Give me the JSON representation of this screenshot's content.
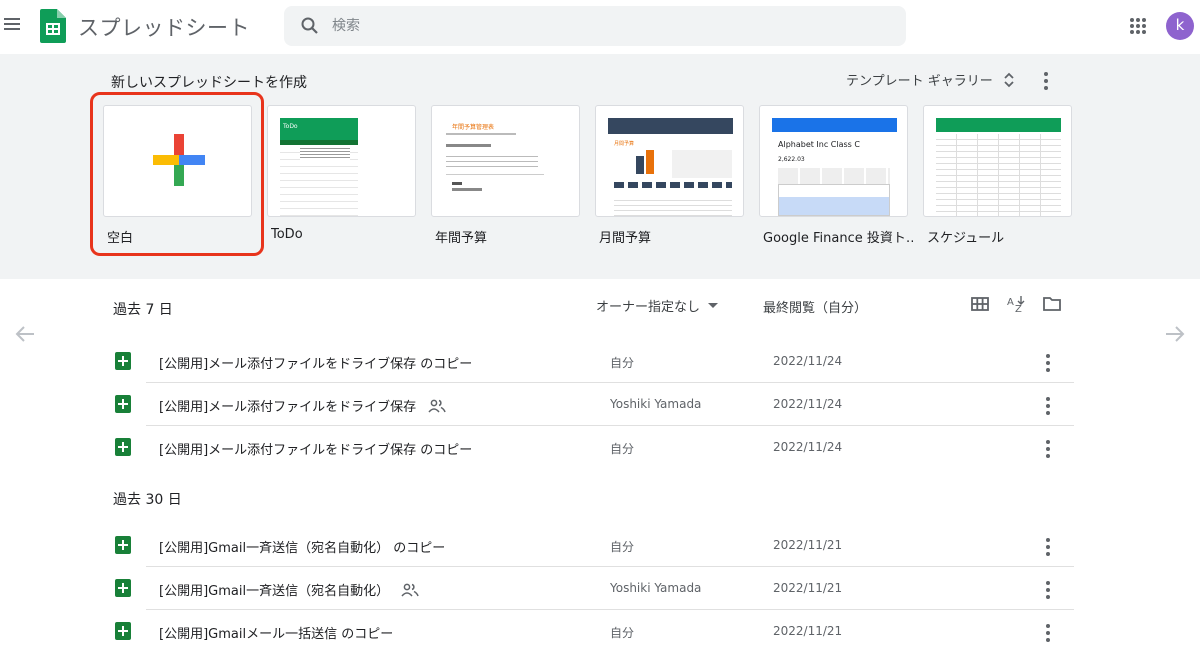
{
  "header": {
    "app_title": "スプレッドシート",
    "search_placeholder": "検索",
    "avatar_letter": "k"
  },
  "gallery": {
    "title": "新しいスプレッドシートを作成",
    "gallery_button": "テンプレート ギャラリー",
    "templates": [
      {
        "label": "空白"
      },
      {
        "label": "ToDo",
        "thumb_heading": "ToDo"
      },
      {
        "label": "年間予算",
        "thumb_heading": "年間予算管理表"
      },
      {
        "label": "月間予算",
        "thumb_heading": "月間予算"
      },
      {
        "label": "Google Finance 投資ト…",
        "thumb_heading": "Alphabet Inc Class C",
        "thumb_value": "2,622.03"
      },
      {
        "label": "スケジュール"
      }
    ]
  },
  "list": {
    "owner_filter": "オーナー指定なし",
    "sort_label": "最終閲覧（自分）",
    "sections": [
      {
        "title": "過去 7 日",
        "files": [
          {
            "name": "[公開用]メール添付ファイルをドライブ保存 のコピー",
            "shared": false,
            "owner": "自分",
            "date": "2022/11/24"
          },
          {
            "name": "[公開用]メール添付ファイルをドライブ保存",
            "shared": true,
            "owner": "Yoshiki Yamada",
            "date": "2022/11/24"
          },
          {
            "name": "[公開用]メール添付ファイルをドライブ保存 のコピー",
            "shared": false,
            "owner": "自分",
            "date": "2022/11/24"
          }
        ]
      },
      {
        "title": "過去 30 日",
        "files": [
          {
            "name": "[公開用]Gmail一斉送信（宛名自動化） のコピー",
            "shared": false,
            "owner": "自分",
            "date": "2022/11/21"
          },
          {
            "name": "[公開用]Gmail一斉送信（宛名自動化）",
            "shared": true,
            "owner": "Yoshiki Yamada",
            "date": "2022/11/21"
          },
          {
            "name": "[公開用]Gmailメール一括送信 のコピー",
            "shared": false,
            "owner": "自分",
            "date": "2022/11/21"
          }
        ]
      }
    ]
  },
  "colors": {
    "sheets_green": "#188038",
    "highlight_red": "#e8341c",
    "avatar": "#8e63ce",
    "gallery_bg": "#f1f3f4"
  },
  "icons": [
    "menu-icon",
    "sheets-logo-icon",
    "search-icon",
    "apps-grid-icon",
    "more-vert-icon",
    "unfold-icon",
    "grid-view-icon",
    "sort-az-icon",
    "folder-icon",
    "people-icon",
    "arrow-left-icon",
    "arrow-right-icon",
    "dropdown-arrow-icon"
  ]
}
